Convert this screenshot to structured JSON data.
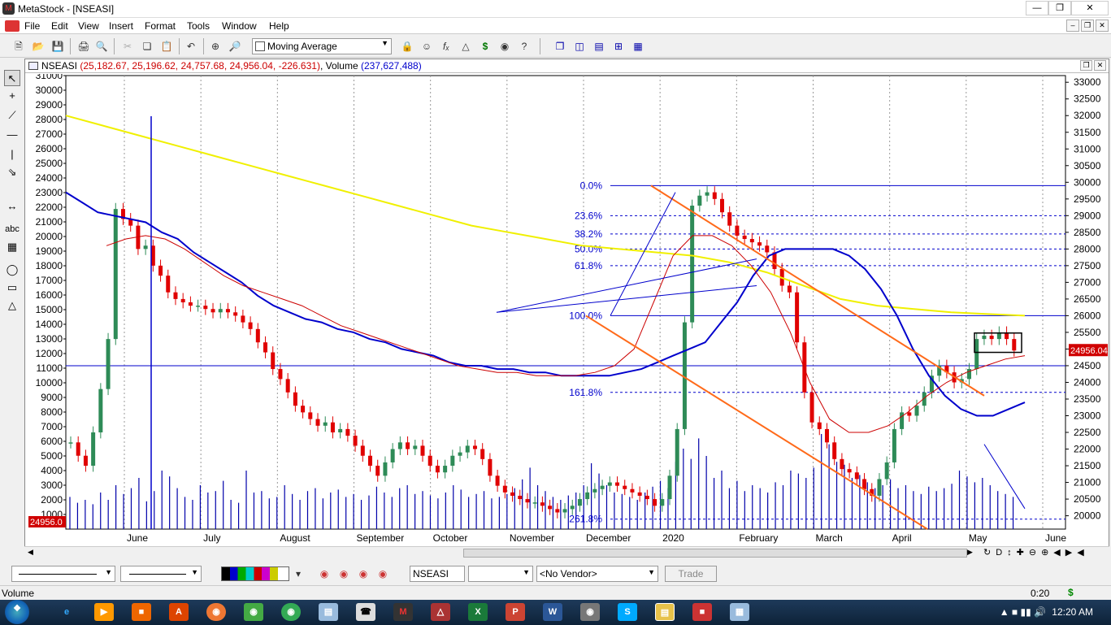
{
  "window": {
    "title": "MetaStock - [NSEASI]"
  },
  "menu": [
    "File",
    "Edit",
    "View",
    "Insert",
    "Format",
    "Tools",
    "Window",
    "Help"
  ],
  "toolbar": {
    "indicator_select": "Moving Average"
  },
  "chart_header": {
    "symbol": "NSEASI",
    "ohlc": "(25,182.67, 25,196.62, 24,757.68, 24,956.04, -226.631)",
    "volume_label": "Volume",
    "volume_value": "(237,627,488)"
  },
  "chart_data": {
    "type": "candlestick",
    "x_axis_labels": [
      "June",
      "July",
      "August",
      "September",
      "October",
      "November",
      "December",
      "2020",
      "February",
      "March",
      "April",
      "May",
      "June"
    ],
    "left_axis_ticks": [
      "31000",
      "30000",
      "29000",
      "28000",
      "27000",
      "26000",
      "25000",
      "24000",
      "23000",
      "22000",
      "21000",
      "20000",
      "19000",
      "18000",
      "17000",
      "16000",
      "15000",
      "14000",
      "13000",
      "12000",
      "11000",
      "10000",
      "9000",
      "8000",
      "7000",
      "6000",
      "5000",
      "4000",
      "3000",
      "2000",
      "1000"
    ],
    "right_axis_ticks": [
      "33000",
      "32500",
      "32000",
      "31500",
      "31000",
      "30500",
      "30000",
      "29500",
      "29000",
      "28500",
      "28000",
      "27500",
      "27000",
      "26500",
      "26000",
      "25500",
      "25000",
      "24500",
      "24000",
      "23500",
      "23000",
      "22500",
      "22000",
      "21500",
      "21000",
      "20500",
      "20000"
    ],
    "last_price_label": "24956.04",
    "volume_last_label": "24956.0",
    "fib_labels": [
      "0.0%",
      "23.6%",
      "38.2%",
      "50.0%",
      "61.8%",
      "100.0%",
      "161.8%",
      "261.8%"
    ],
    "fib_levels": [
      29900,
      29000,
      28450,
      28000,
      27500,
      26000,
      23700,
      19900
    ],
    "right_ylim": [
      19600,
      33200
    ],
    "close_series": [
      22200,
      21800,
      21500,
      22500,
      23800,
      25300,
      29200,
      28900,
      28700,
      28000,
      28100,
      27500,
      27200,
      26700,
      26500,
      26400,
      26300,
      26300,
      26200,
      26100,
      26200,
      26100,
      26000,
      25800,
      25600,
      25200,
      24900,
      24400,
      24100,
      23700,
      23300,
      23100,
      22900,
      22700,
      22800,
      22500,
      22600,
      22400,
      22100,
      21800,
      21500,
      21200,
      21600,
      22000,
      22200,
      22000,
      22100,
      21800,
      21500,
      21300,
      21500,
      21800,
      21900,
      22100,
      22000,
      21700,
      21200,
      20900,
      20700,
      20600,
      20500,
      20400,
      20400,
      20300,
      20200,
      20100,
      20200,
      20300,
      20500,
      20700,
      20800,
      20900,
      21000,
      20900,
      20800,
      20700,
      20600,
      20500,
      20300,
      20500,
      21200,
      22600,
      25800,
      29300,
      29600,
      29700,
      29500,
      29100,
      28700,
      28400,
      28300,
      28200,
      28100,
      27900,
      27400,
      26900,
      26700,
      25200,
      23700,
      22800,
      22600,
      22200,
      21700,
      21400,
      21300,
      21100,
      20800,
      20600,
      21100,
      21600,
      22600,
      23100,
      23000,
      23300,
      23700,
      24200,
      24500,
      24300,
      24000,
      24100,
      24400,
      25300,
      25400,
      25300,
      25500,
      25300,
      24956
    ],
    "ma_blue_series": [
      29700,
      29400,
      29100,
      29000,
      28900,
      28800,
      28500,
      28300,
      27900,
      27600,
      27300,
      27000,
      26600,
      26300,
      26100,
      25900,
      25800,
      25600,
      25500,
      25300,
      25200,
      25000,
      24900,
      24800,
      24600,
      24500,
      24500,
      24400,
      24400,
      24300,
      24300,
      24200,
      24200,
      24200,
      24200,
      24300,
      24400,
      24600,
      24800,
      25000,
      25200,
      25800,
      26400,
      27200,
      27800,
      28000,
      28000,
      28000,
      28000,
      27800,
      27400,
      26800,
      26000,
      25000,
      24200,
      23600,
      23200,
      23000,
      23000,
      23200,
      23400
    ],
    "ma_red_series": [
      28100,
      28300,
      28400,
      28300,
      28000,
      27600,
      27200,
      26900,
      26700,
      26500,
      26300,
      26000,
      25700,
      25500,
      25300,
      25100,
      24900,
      24700,
      24500,
      24400,
      24300,
      24300,
      24200,
      24200,
      24200,
      24300,
      24500,
      25000,
      26400,
      27800,
      28400,
      28400,
      28100,
      27500,
      26700,
      25500,
      24000,
      22900,
      22500,
      22500,
      22700,
      23100,
      23600,
      24000,
      24300,
      24500,
      24700,
      24800
    ],
    "ma_yellow_series": [
      32000,
      31700,
      31400,
      31100,
      30800,
      30500,
      30200,
      29900,
      29600,
      29300,
      29000,
      28700,
      28500,
      28300,
      28100,
      28000,
      27900,
      27800,
      27600,
      27300,
      26900,
      26500,
      26300,
      26200,
      26100,
      26050,
      26000
    ],
    "volume_bars": [
      2200,
      1800,
      2000,
      1700,
      2500,
      2000,
      3000,
      2400,
      2800,
      3500,
      1900,
      2600,
      4000,
      3600,
      2800,
      2200,
      2000,
      3000,
      2500,
      2600,
      3300,
      2000,
      1800,
      4000,
      2500,
      2600,
      2100,
      2200,
      3000,
      2400,
      2000,
      2600,
      2800,
      2100,
      2500,
      2700,
      2200,
      2400,
      2000,
      2300,
      2900,
      2500,
      2200,
      2800,
      3000,
      2400,
      2600,
      2300,
      2100,
      2500,
      3000,
      2700,
      2200,
      2400,
      2600,
      2100,
      2200,
      2400,
      2800,
      3400,
      4200,
      3000,
      2600,
      2200,
      2000,
      2300,
      2500,
      3000,
      4500,
      3800,
      3000,
      2500,
      2400,
      2200,
      2000,
      2500,
      2900,
      3300,
      2800,
      4600,
      5500,
      4800,
      6200,
      5000,
      3500,
      4000,
      2800,
      3300,
      2600,
      3000,
      2800,
      2500,
      3200,
      3000,
      4000,
      3800,
      3500,
      4200,
      6500,
      5800,
      4600,
      4400,
      3500,
      3700,
      3200,
      2800,
      3000,
      3400,
      2800,
      3000,
      2600,
      2400,
      2900,
      2600,
      2800,
      3100,
      4000,
      3600,
      3200,
      3500,
      3000,
      2600,
      2400,
      2200
    ],
    "volume_ylim": [
      0,
      31000
    ]
  },
  "bottom_toolbar": {
    "symbol_field": "NSEASI",
    "vendor_select": "<No Vendor>",
    "trade_button": "Trade"
  },
  "status": {
    "left": "Volume",
    "right": "0:20",
    "dollar": "$"
  },
  "taskbar": {
    "clock": "12:20 AM"
  },
  "colors": {
    "bull": "#2e8b57",
    "bear": "#e00000",
    "ma_blue": "#0000cc",
    "ma_red": "#cc0000",
    "ma_yellow": "#f0f000",
    "channel": "#ff6a1a",
    "volume": "#0000aa"
  }
}
